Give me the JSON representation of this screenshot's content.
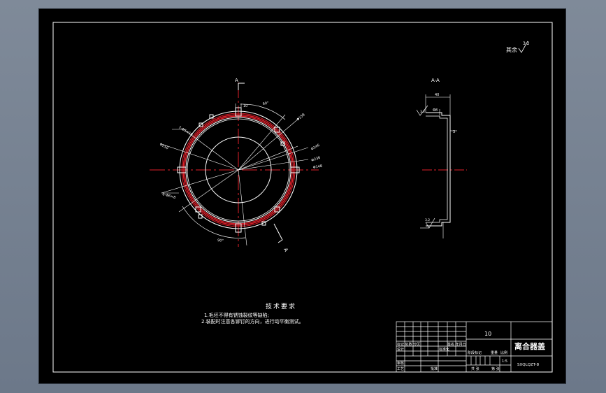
{
  "drawing": {
    "roughness_note": {
      "label": "其余",
      "value": "3.2"
    },
    "section_label": "A-A",
    "cut_label_top": "A",
    "cut_label_bottom": "A",
    "front_view_dims": [
      "10",
      "60°",
      "Φ158",
      "Φ146",
      "Φ236",
      "Φ148",
      "Φ250",
      "7-Φ5×10",
      "6-Φ6×8",
      "90°"
    ],
    "section_dims": {
      "top": "40",
      "left": "Φ8",
      "mid": "3",
      "roughness_top": "3.2",
      "roughness_bottom": "3.2"
    }
  },
  "requirements": {
    "title": "技术要求",
    "items": [
      "1.毛坯不得有锈蚀裂纹等缺陷;",
      "2.装配时注意各铆钉的方向，进行动平衡测试。"
    ]
  },
  "title_block": {
    "quantity": "10",
    "part_name": "离合器盖",
    "drawing_no": "SXQLQZT-8",
    "scale": "1:5",
    "labels": {
      "revision_row": "标记 处数 分区",
      "designer": "设计",
      "standardize": "标准化",
      "signature_date": "签名 年月日",
      "stage_mark": "阶段标记",
      "weight": "重量",
      "scale_label": "比例",
      "review": "审核",
      "process": "工艺",
      "approve": "批准",
      "sheets_total": "共 张",
      "sheet_no": "第 张"
    }
  }
}
